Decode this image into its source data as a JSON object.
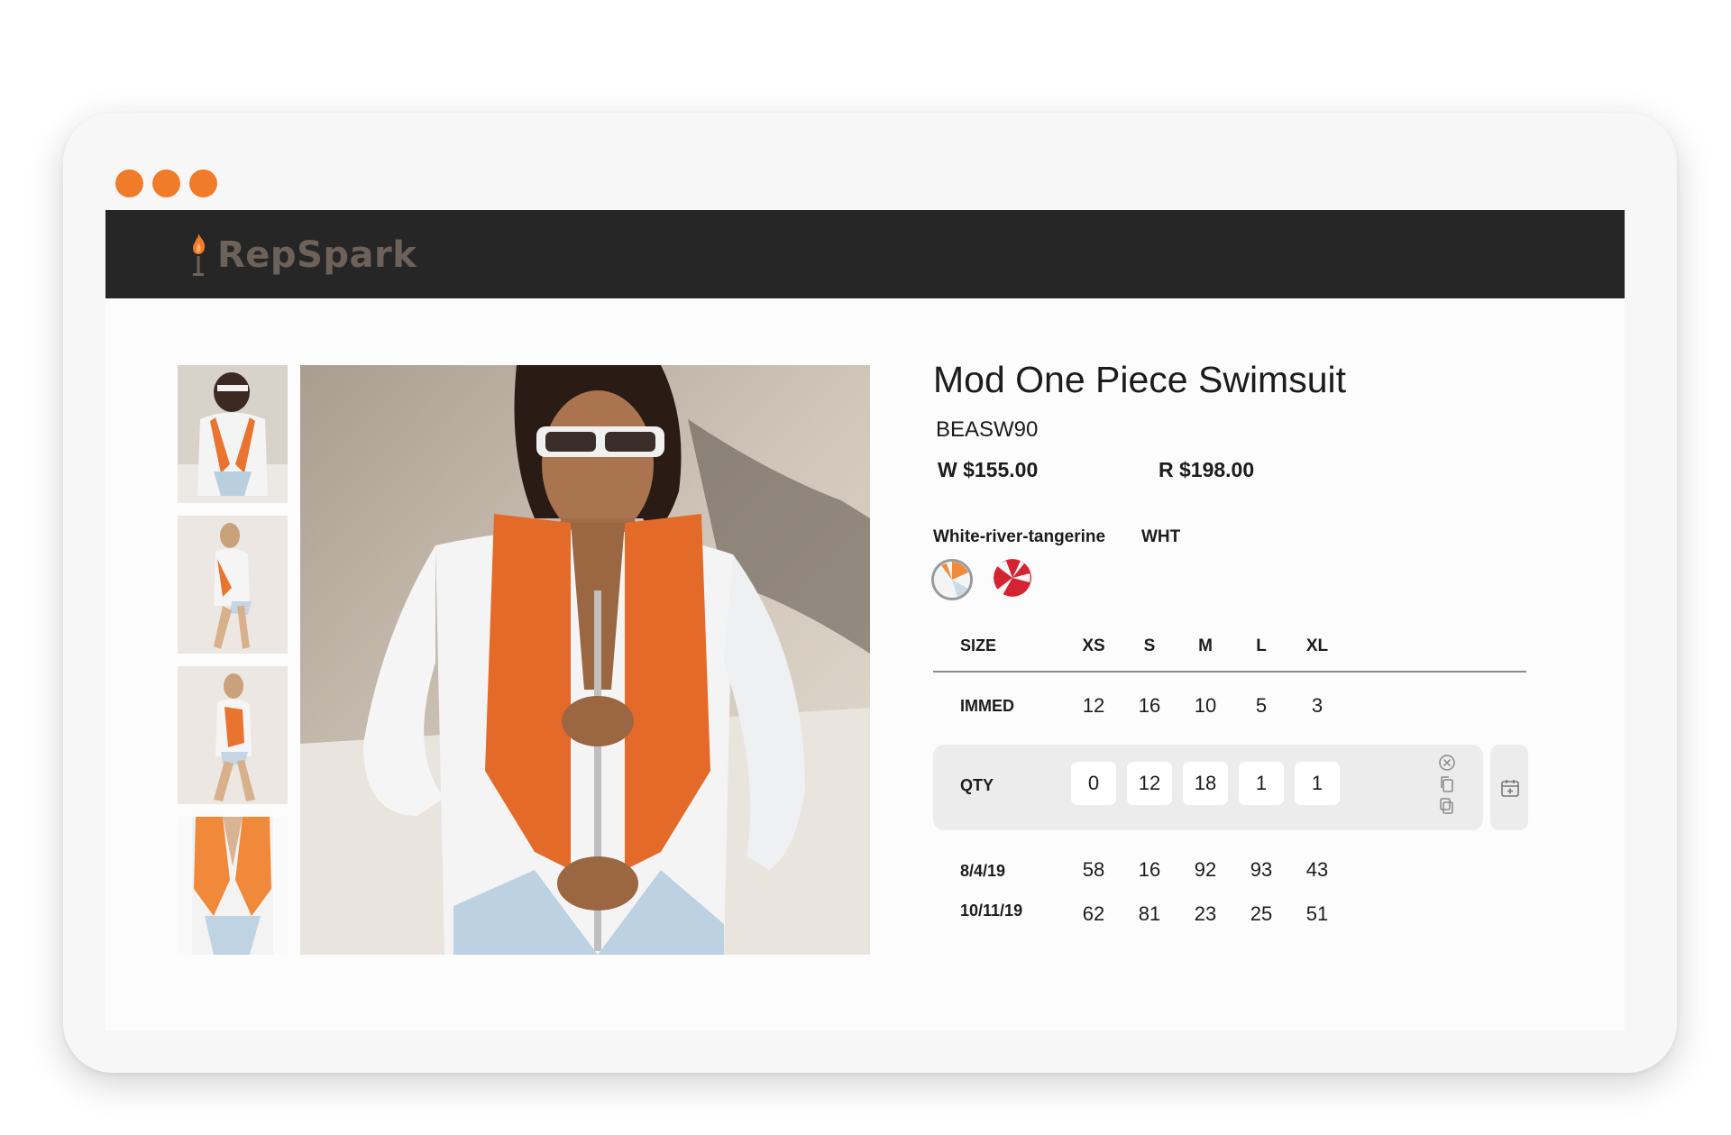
{
  "brand": {
    "name": "RepSpark",
    "accent": "#f07c2a"
  },
  "product": {
    "title": "Mod One Piece Swimsuit",
    "sku": "BEASW90",
    "wholesale": "W $155.00",
    "retail": "R $198.00",
    "color_name": "White-river-tangerine",
    "color_code": "WHT",
    "swatches": [
      "white-orange-swatch",
      "red-white-swatch"
    ]
  },
  "grid": {
    "size_label": "SIZE",
    "sizes": [
      "XS",
      "S",
      "M",
      "L",
      "XL"
    ],
    "immed_label": "IMMED",
    "immed": [
      "12",
      "16",
      "10",
      "5",
      "3"
    ],
    "qty_label": "QTY",
    "qty": [
      "0",
      "12",
      "18",
      "1",
      "1"
    ],
    "future": [
      {
        "date": "8/4/19",
        "values": [
          "58",
          "16",
          "92",
          "93",
          "43"
        ]
      },
      {
        "date": "10/11/19",
        "values": [
          "62",
          "81",
          "23",
          "25",
          "51"
        ]
      }
    ]
  },
  "icons": {
    "clear": "close-circle-icon",
    "copy": "copy-icon",
    "paste": "paste-icon",
    "calendar": "calendar-add-icon"
  }
}
